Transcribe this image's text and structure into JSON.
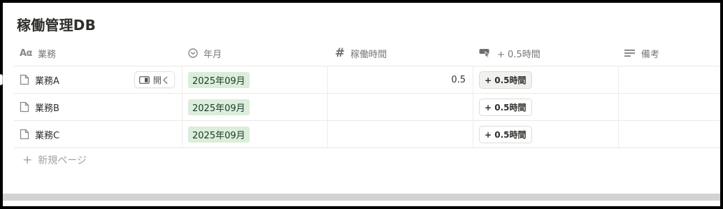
{
  "database": {
    "title": "稼働管理DB"
  },
  "columns": [
    {
      "label": "業務",
      "icon": "title-aa-icon"
    },
    {
      "label": "年月",
      "icon": "select-circle-icon"
    },
    {
      "label": "稼働時間",
      "icon": "number-hash-icon"
    },
    {
      "label": "+ 0.5時間",
      "icon": "button-click-icon"
    },
    {
      "label": "備考",
      "icon": "text-lines-icon"
    }
  ],
  "header_icons": {
    "title": "Aα",
    "number": "#"
  },
  "rows": [
    {
      "name": "業務A",
      "date": "2025年09月",
      "hours": "0.5",
      "action": "+ 0.5時間",
      "note": ""
    },
    {
      "name": "業務B",
      "date": "2025年09月",
      "hours": "",
      "action": "+ 0.5時間",
      "note": ""
    },
    {
      "name": "業務C",
      "date": "2025年09月",
      "hours": "",
      "action": "+ 0.5時間",
      "note": ""
    }
  ],
  "row_actions": {
    "open_label": "開く"
  },
  "footer": {
    "new_page_label": "新規ページ",
    "plus": "+"
  },
  "colors": {
    "date_tag_bg": "#dbeddb",
    "date_tag_text": "#1c3829"
  }
}
